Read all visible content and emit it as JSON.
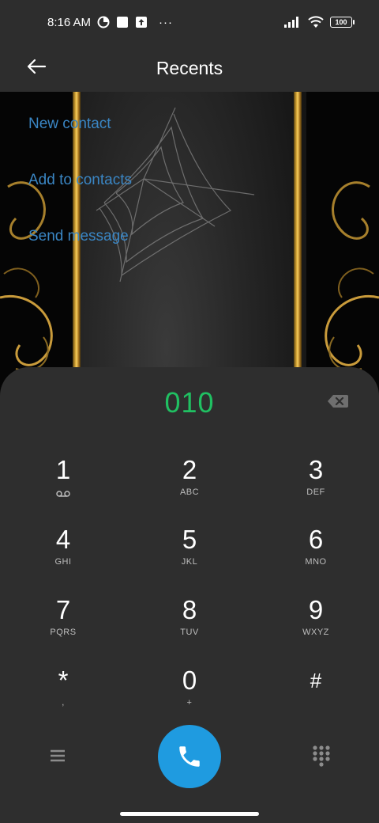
{
  "status_bar": {
    "time": "8:16 AM",
    "icons_left": [
      "data-saver-icon",
      "square-notification-icon",
      "upload-icon",
      "more-dots-icon"
    ],
    "more": "···",
    "icons_right": [
      "signal-icon",
      "wifi-icon",
      "battery-icon"
    ],
    "battery": "100"
  },
  "app_bar": {
    "title": "Recents",
    "back_icon": "arrow-left-icon"
  },
  "actions": [
    {
      "label": "New contact"
    },
    {
      "label": "Add to contacts"
    },
    {
      "label": "Send message"
    }
  ],
  "dialer": {
    "number": "010",
    "backspace_icon": "backspace-icon",
    "keys": [
      {
        "digit": "1",
        "letters": "",
        "icon": "voicemail-icon"
      },
      {
        "digit": "2",
        "letters": "ABC"
      },
      {
        "digit": "3",
        "letters": "DEF"
      },
      {
        "digit": "4",
        "letters": "GHI"
      },
      {
        "digit": "5",
        "letters": "JKL"
      },
      {
        "digit": "6",
        "letters": "MNO"
      },
      {
        "digit": "7",
        "letters": "PQRS"
      },
      {
        "digit": "8",
        "letters": "TUV"
      },
      {
        "digit": "9",
        "letters": "WXYZ"
      },
      {
        "digit": "*",
        "letters": ","
      },
      {
        "digit": "0",
        "letters": "+"
      },
      {
        "digit": "#",
        "letters": ""
      }
    ],
    "bottom": {
      "menu_icon": "menu-icon",
      "call_icon": "phone-icon",
      "dialpad_icon": "dialpad-icon"
    }
  },
  "colors": {
    "accent_number": "#20c062",
    "link_blue": "#3a86c4",
    "call_button": "#1f9be0",
    "sheet_background": "#2e2e2e",
    "bar_background": "#2d2d2d"
  }
}
